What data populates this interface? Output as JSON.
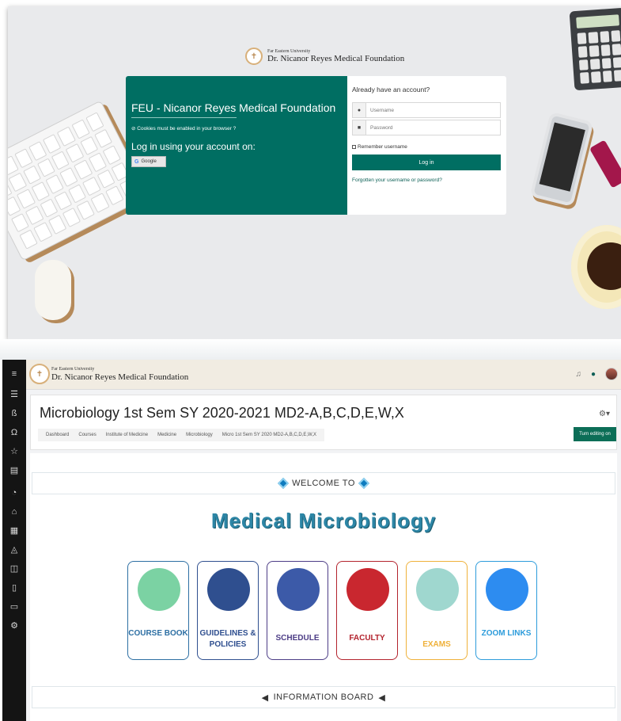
{
  "colors": {
    "brand_green": "#006e62",
    "edit_green": "#0c6e57",
    "title_blue": "#2d86a6",
    "rail_dark": "#141414"
  },
  "login": {
    "brand_small": "Far Eastern University",
    "brand_big": "Dr. Nicanor Reyes Medical Foundation",
    "site_name": "FEU - Nicanor Reyes Medical Foundation",
    "cookies_notice": "Cookies must be enabled in your browser",
    "login_using": "Log in using your account on:",
    "google_label": "Google",
    "already": "Already have an account?",
    "username_placeholder": "Username",
    "password_placeholder": "Password",
    "remember_label": "Remember username",
    "login_button": "Log in",
    "forgot_link": "Forgotten your username or password?"
  },
  "course": {
    "topbar": {
      "brand_small": "Far Eastern University",
      "brand_big": "Dr. Nicanor Reyes Medical Foundation"
    },
    "title": "Microbiology 1st Sem SY 2020-2021 MD2-A,B,C,D,E,W,X",
    "breadcrumbs": [
      "Dashboard",
      "Courses",
      "Institute of Medicine",
      "Medicine",
      "Microbiology",
      "Micro 1st Sem SY 2020 MD2-A,B,C,D,E,W,X"
    ],
    "edit_button": "Turn editing on",
    "welcome": "WELCOME TO",
    "big_title": "Medical Microbiology",
    "tiles": [
      {
        "label": "COURSE BOOK",
        "color": "#2d6fa3",
        "icon": "book-magnifier-icon"
      },
      {
        "label": "GUIDELINES & POLICIES",
        "color": "#2f4f8f",
        "icon": "document-hand-icon"
      },
      {
        "label": "SCHEDULE",
        "color": "#4d3d86",
        "icon": "calendar-icon"
      },
      {
        "label": "FACULTY",
        "color": "#b3232d",
        "icon": "faculty-people-icon"
      },
      {
        "label": "EXAMS",
        "color": "#efb13a",
        "icon": "clipboard-pencil-icon"
      },
      {
        "label": "ZOOM LINKS",
        "color": "#2d9cdb",
        "icon": "video-camera-icon"
      }
    ],
    "info_board": "INFORMATION BOARD"
  }
}
